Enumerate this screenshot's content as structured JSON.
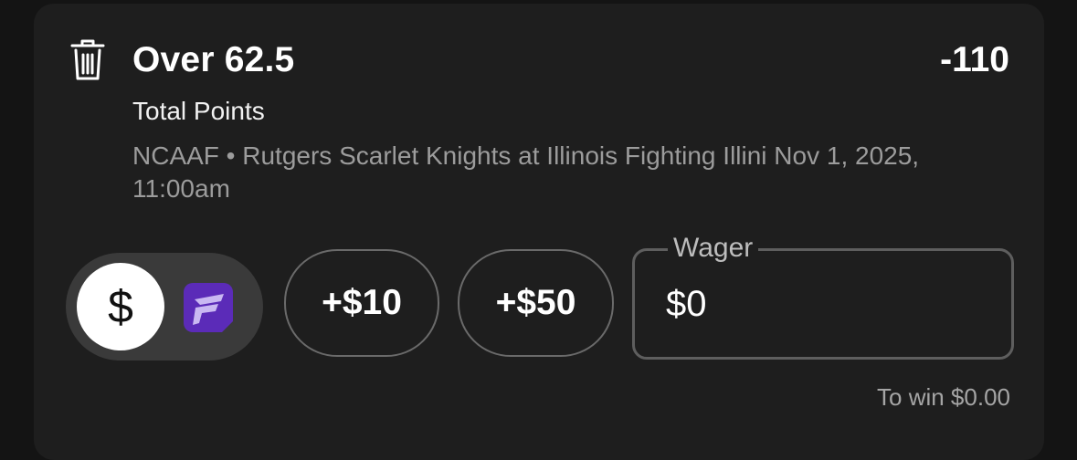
{
  "bet": {
    "selection": "Over 62.5",
    "odds": "-110",
    "market": "Total Points",
    "event": "NCAAF • Rutgers Scarlet Knights at Illinois Fighting Illini Nov 1, 2025, 11:00am"
  },
  "toggle": {
    "cash_symbol": "$",
    "cash_icon": "dollar-icon",
    "bonus_icon": "fanatics-logo-icon",
    "active": "cash"
  },
  "quick_adds": [
    {
      "label": "+$10"
    },
    {
      "label": "+$50"
    }
  ],
  "wager": {
    "label": "Wager",
    "value": "$0"
  },
  "payout": {
    "to_win": "To win $0.00"
  },
  "colors": {
    "background": "#141414",
    "card": "#1e1e1e",
    "toggle_track": "#3a3a3a",
    "brand_purple": "#5b2bb8"
  }
}
